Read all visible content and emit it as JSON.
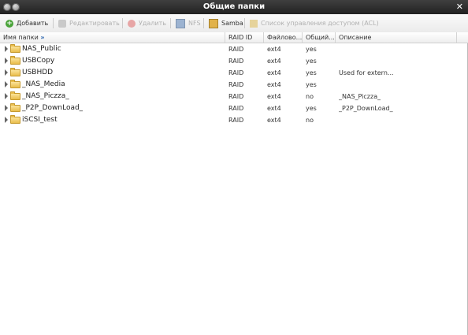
{
  "window": {
    "title": "Общие папки"
  },
  "toolbar": {
    "add": "Добавить",
    "edit": "Редактировать",
    "delete": "Удалить",
    "nfs": "NFS",
    "samba": "Samba",
    "acl": "Список управления доступом (ACL)"
  },
  "columns": {
    "name": "Имя папки",
    "raid": "RAID ID",
    "fs": "Файлово...",
    "public": "Общий...",
    "desc": "Описание"
  },
  "rows": [
    {
      "name": "NAS_Public",
      "raid": "RAID",
      "fs": "ext4",
      "public": "yes",
      "desc": ""
    },
    {
      "name": "USBCopy",
      "raid": "RAID",
      "fs": "ext4",
      "public": "yes",
      "desc": ""
    },
    {
      "name": "USBHDD",
      "raid": "RAID",
      "fs": "ext4",
      "public": "yes",
      "desc": "Used for extern..."
    },
    {
      "name": "_NAS_Media",
      "raid": "RAID",
      "fs": "ext4",
      "public": "yes",
      "desc": ""
    },
    {
      "name": "_NAS_Piczza_",
      "raid": "RAID",
      "fs": "ext4",
      "public": "no",
      "desc": "_NAS_Piczza_"
    },
    {
      "name": "_P2P_DownLoad_",
      "raid": "RAID",
      "fs": "ext4",
      "public": "yes",
      "desc": "_P2P_DownLoad_"
    },
    {
      "name": "iSCSI_test",
      "raid": "RAID",
      "fs": "ext4",
      "public": "no",
      "desc": ""
    }
  ]
}
